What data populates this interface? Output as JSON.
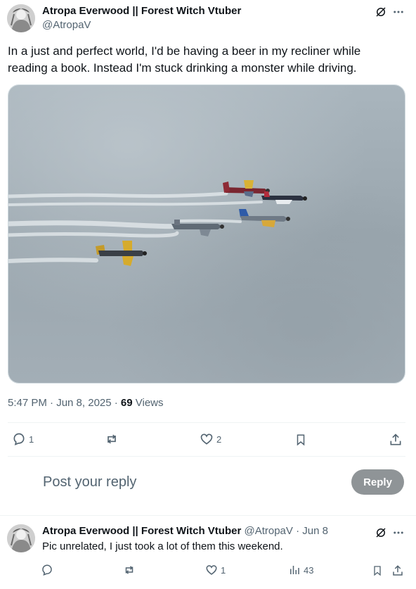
{
  "post": {
    "author_name": "Atropa Everwood || Forest Witch Vtuber",
    "handle": "@AtropaV",
    "text": "In a just and perfect world, I'd be having a beer in my recliner while reading a book. Instead I'm stuck drinking a monster while driving.",
    "time": "5:47 PM · Jun 8, 2025 · ",
    "views_count": "69",
    "views_label": " Views",
    "media_icon": "grok-icon",
    "more_icon": "more-icon"
  },
  "actions": {
    "replies": "1",
    "reposts": "",
    "likes": "2"
  },
  "composer": {
    "placeholder": "Post your reply",
    "button_label": "Reply"
  },
  "reply": {
    "author_name": "Atropa Everwood || Forest Witch Vtuber",
    "handle": "@AtropaV",
    "dot": "·",
    "date": "Jun 8",
    "text": "Pic unrelated, I just took a lot of them this weekend.",
    "likes": "1",
    "views": "43"
  },
  "colors": {
    "accent_text": "#0f1419",
    "muted": "#536471",
    "reply_button": "#8f9497",
    "divider": "#eff3f4"
  }
}
